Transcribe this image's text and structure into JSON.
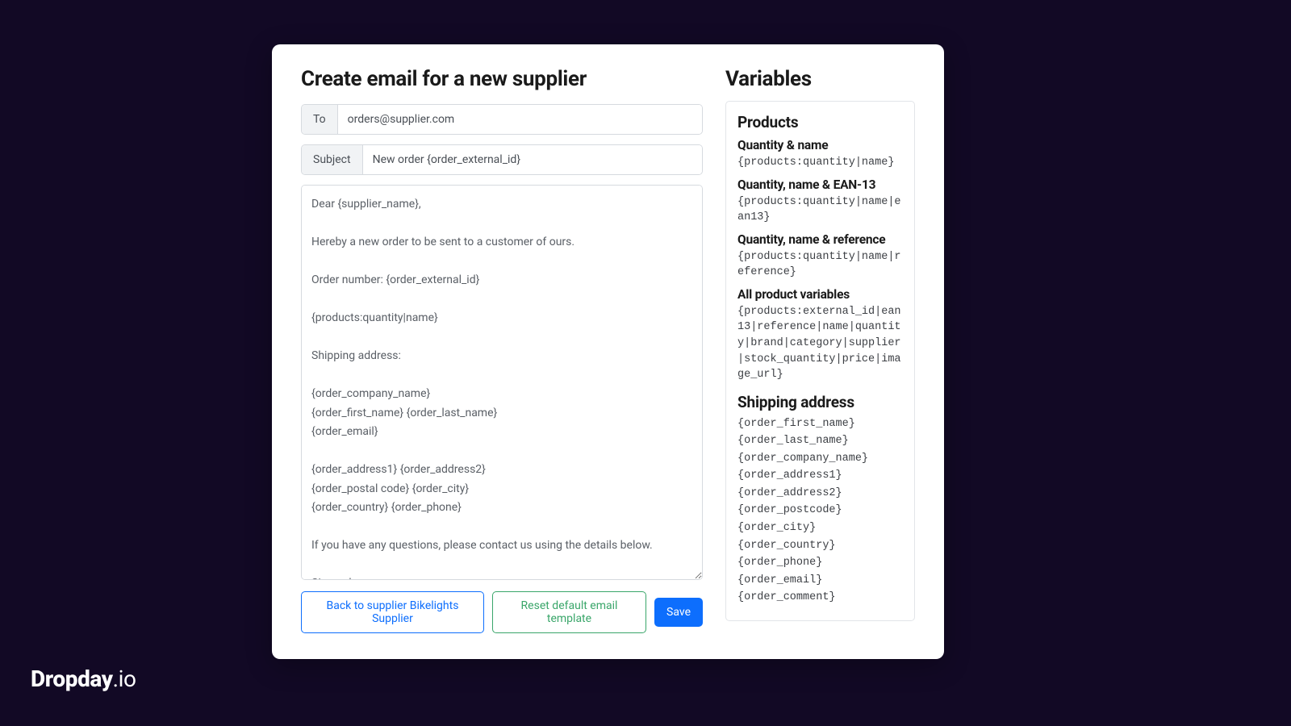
{
  "brand": {
    "name": "Dropday",
    "tld": ".io"
  },
  "form": {
    "title": "Create email for a new supplier",
    "to_label": "To",
    "to_value": "orders@supplier.com",
    "subject_label": "Subject",
    "subject_value": "New order {order_external_id}",
    "body": "Dear {supplier_name},\n\nHereby a new order to be sent to a customer of ours.\n\nOrder number: {order_external_id}\n\n{products:quantity|name}\n\nShipping address:\n\n{order_company_name}\n{order_first_name} {order_last_name}\n{order_email}\n\n{order_address1} {order_address2}\n{order_postal code} {order_city}\n{order_country} {order_phone}\n\nIf you have any questions, please contact us using the details below.\n\nSincerely,\n\n{merchant_company_name}",
    "buttons": {
      "back": "Back to supplier Bikelights Supplier",
      "reset": "Reset default email template",
      "save": "Save"
    }
  },
  "variables": {
    "title": "Variables",
    "products_title": "Products",
    "groups": [
      {
        "label": "Quantity & name",
        "code": "{products:quantity|name}"
      },
      {
        "label": "Quantity, name & EAN-13",
        "code": "{products:quantity|name|ean13}"
      },
      {
        "label": "Quantity, name & reference",
        "code": "{products:quantity|name|reference}"
      },
      {
        "label": "All product variables",
        "code": "{products:external_id|ean13|reference|name|quantity|brand|category|supplier|stock_quantity|price|image_url}"
      }
    ],
    "shipping_title": "Shipping address",
    "shipping_vars": [
      "{order_first_name}",
      "{order_last_name}",
      "{order_company_name}",
      "{order_address1}",
      "{order_address2}",
      "{order_postcode}",
      "{order_city}",
      "{order_country}",
      "{order_phone}",
      "{order_email}",
      "{order_comment}"
    ]
  }
}
